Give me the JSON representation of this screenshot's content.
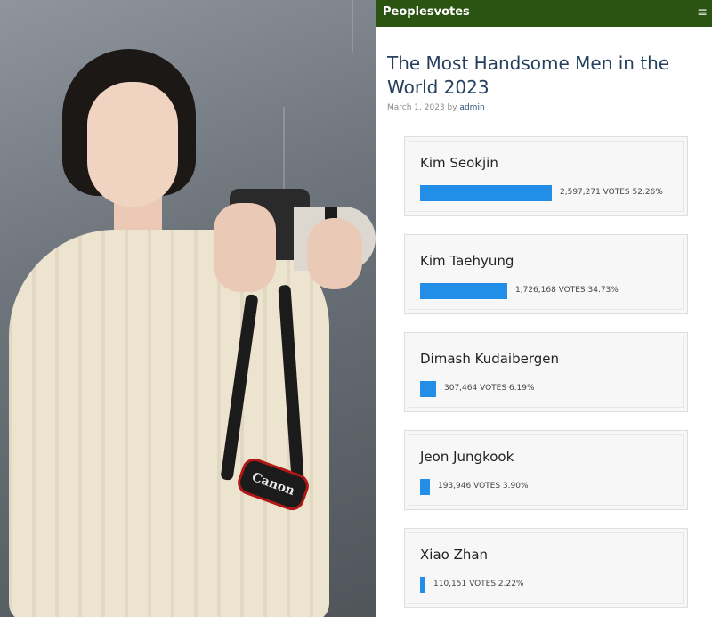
{
  "header": {
    "brand": "Peoplesvotes",
    "menu_icon": "hamburger-menu-icon"
  },
  "article": {
    "title": "The Most Handsome Men in the World 2023",
    "date": "March 1, 2023",
    "by": "by",
    "author": "admin"
  },
  "photo": {
    "strap_text": "Canon"
  },
  "candidates": [
    {
      "name": "Kim Seokjin",
      "votes": "2,597,271 VOTES 52.26%",
      "percent": 52.26
    },
    {
      "name": "Kim Taehyung",
      "votes": "1,726,168 VOTES 34.73%",
      "percent": 34.73
    },
    {
      "name": "Dimash Kudaibergen",
      "votes": "307,464 VOTES 6.19%",
      "percent": 6.19
    },
    {
      "name": "Jeon Jungkook",
      "votes": "193,946 VOTES 3.90%",
      "percent": 3.9
    },
    {
      "name": "Xiao Zhan",
      "votes": "110,151 VOTES 2.22%",
      "percent": 2.22
    }
  ],
  "colors": {
    "bar": "#238ee8",
    "topbar": "#2b5311",
    "title": "#24405e"
  }
}
